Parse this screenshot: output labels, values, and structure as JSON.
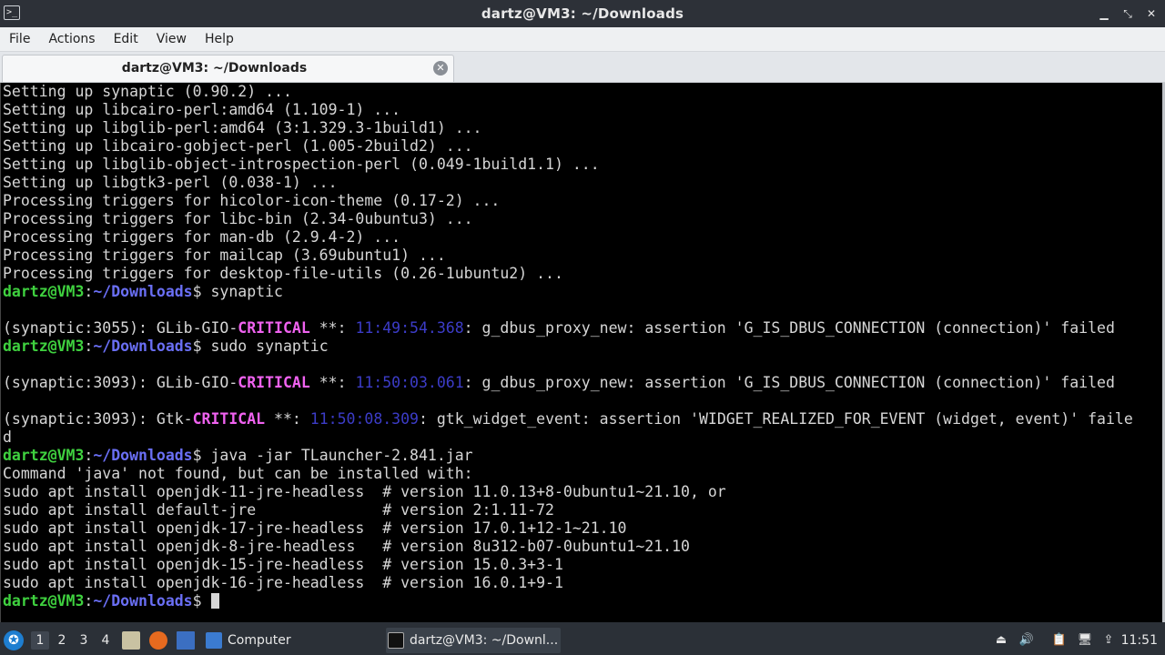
{
  "window": {
    "title": "dartz@VM3: ~/Downloads",
    "icon": "terminal-icon",
    "buttons": [
      "minimize",
      "maximize",
      "close"
    ],
    "btn_glyphs": [
      "▁",
      "⤡",
      "✕"
    ]
  },
  "menu": [
    "File",
    "Actions",
    "Edit",
    "View",
    "Help"
  ],
  "tab": {
    "label": "dartz@VM3: ~/Downloads",
    "close_glyph": "✕"
  },
  "terminal": {
    "lines": [
      [
        {
          "t": "Setting up synaptic (0.90.2) ..."
        }
      ],
      [
        {
          "t": "Setting up libcairo-perl:amd64 (1.109-1) ..."
        }
      ],
      [
        {
          "t": "Setting up libglib-perl:amd64 (3:1.329.3-1build1) ..."
        }
      ],
      [
        {
          "t": "Setting up libcairo-gobject-perl (1.005-2build2) ..."
        }
      ],
      [
        {
          "t": "Setting up libglib-object-introspection-perl (0.049-1build1.1) ..."
        }
      ],
      [
        {
          "t": "Setting up libgtk3-perl (0.038-1) ..."
        }
      ],
      [
        {
          "t": "Processing triggers for hicolor-icon-theme (0.17-2) ..."
        }
      ],
      [
        {
          "t": "Processing triggers for libc-bin (2.34-0ubuntu3) ..."
        }
      ],
      [
        {
          "t": "Processing triggers for man-db (2.9.4-2) ..."
        }
      ],
      [
        {
          "t": "Processing triggers for mailcap (3.69ubuntu1) ..."
        }
      ],
      [
        {
          "t": "Processing triggers for desktop-file-utils (0.26-1ubuntu2) ..."
        }
      ],
      [
        {
          "t": "dartz@VM3",
          "c": "g"
        },
        {
          "t": ":"
        },
        {
          "t": "~/Downloads",
          "c": "b"
        },
        {
          "t": "$ synaptic"
        }
      ],
      [
        {
          "t": ""
        }
      ],
      [
        {
          "t": "(synaptic:3055): GLib-GIO-"
        },
        {
          "t": "CRITICAL",
          "c": "m"
        },
        {
          "t": " **: "
        },
        {
          "t": "11:49:54.368",
          "c": "t"
        },
        {
          "t": ": g_dbus_proxy_new: assertion 'G_IS_DBUS_CONNECTION (connection)' failed"
        }
      ],
      [
        {
          "t": "dartz@VM3",
          "c": "g"
        },
        {
          "t": ":"
        },
        {
          "t": "~/Downloads",
          "c": "b"
        },
        {
          "t": "$ sudo synaptic"
        }
      ],
      [
        {
          "t": ""
        }
      ],
      [
        {
          "t": "(synaptic:3093): GLib-GIO-"
        },
        {
          "t": "CRITICAL",
          "c": "m"
        },
        {
          "t": " **: "
        },
        {
          "t": "11:50:03.061",
          "c": "t"
        },
        {
          "t": ": g_dbus_proxy_new: assertion 'G_IS_DBUS_CONNECTION (connection)' failed"
        }
      ],
      [
        {
          "t": ""
        }
      ],
      [
        {
          "t": "(synaptic:3093): Gtk-"
        },
        {
          "t": "CRITICAL",
          "c": "m"
        },
        {
          "t": " **: "
        },
        {
          "t": "11:50:08.309",
          "c": "t"
        },
        {
          "t": ": gtk_widget_event: assertion 'WIDGET_REALIZED_FOR_EVENT (widget, event)' faile"
        }
      ],
      [
        {
          "t": "d"
        }
      ],
      [
        {
          "t": "dartz@VM3",
          "c": "g"
        },
        {
          "t": ":"
        },
        {
          "t": "~/Downloads",
          "c": "b"
        },
        {
          "t": "$ java -jar TLauncher-2.841.jar"
        }
      ],
      [
        {
          "t": "Command 'java' not found, but can be installed with:"
        }
      ],
      [
        {
          "t": "sudo apt install openjdk-11-jre-headless  # version 11.0.13+8-0ubuntu1~21.10, or"
        }
      ],
      [
        {
          "t": "sudo apt install default-jre              # version 2:1.11-72"
        }
      ],
      [
        {
          "t": "sudo apt install openjdk-17-jre-headless  # version 17.0.1+12-1~21.10"
        }
      ],
      [
        {
          "t": "sudo apt install openjdk-8-jre-headless   # version 8u312-b07-0ubuntu1~21.10"
        }
      ],
      [
        {
          "t": "sudo apt install openjdk-15-jre-headless  # version 15.0.3+3-1"
        }
      ],
      [
        {
          "t": "sudo apt install openjdk-16-jre-headless  # version 16.0.1+9-1"
        }
      ],
      [
        {
          "t": "dartz@VM3",
          "c": "g"
        },
        {
          "t": ":"
        },
        {
          "t": "~/Downloads",
          "c": "b"
        },
        {
          "t": "$ "
        },
        {
          "cursor": true
        }
      ]
    ]
  },
  "taskbar": {
    "start_glyph": "✪",
    "workspaces": [
      "1",
      "2",
      "3",
      "4"
    ],
    "active_workspace": "1",
    "quicklaunch": [
      "file-manager-icon",
      "firefox-icon",
      "desktop-icon"
    ],
    "tasks": [
      {
        "label": "Computer",
        "icon": "folder-icon"
      },
      {
        "label": "dartz@VM3: ~/Downl...",
        "icon": "terminal-icon"
      }
    ],
    "tray": [
      "eject-icon",
      "volume-icon",
      "clipboard-icon",
      "network-icon",
      "update-icon"
    ],
    "tray_glyphs": [
      "⏏",
      "🔊",
      "📋",
      "🖥",
      "⇪"
    ],
    "clock": "11:51"
  }
}
